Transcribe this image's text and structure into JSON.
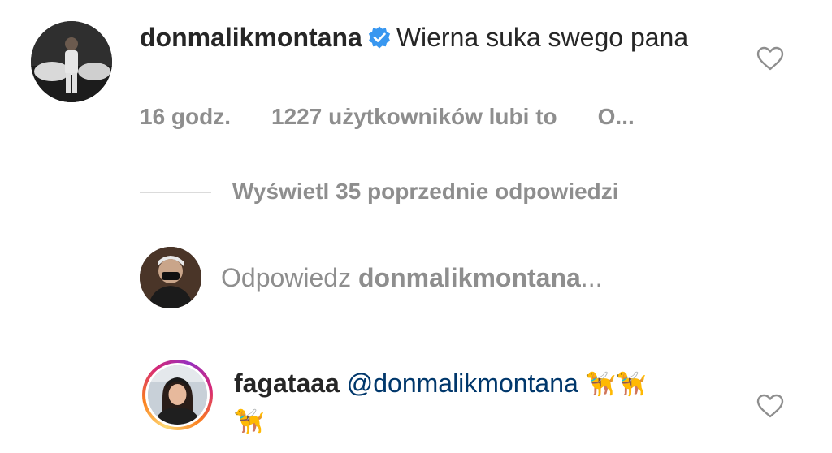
{
  "comment": {
    "username": "donmalikmontana",
    "verified": true,
    "text": "Wierna suka swego pana",
    "time": "16 godz.",
    "likes": "1227 użytkowników lubi to",
    "reply_truncated": "O...",
    "avatar_icon": "profile-photo-man-with-car",
    "like_icon": "heart-outline-icon"
  },
  "previous_replies": {
    "label": "Wyświetl 35 poprzednie odpowiedzi"
  },
  "reply_input": {
    "prefix": "Odpowiedz",
    "username": "donmalikmontana",
    "ellipsis": "..."
  },
  "reply": {
    "username": "fagataaa",
    "mention": "@donmalikmontana",
    "emoji_line1": "🦮🦮",
    "emoji_line2": "🦮",
    "story_ring": true,
    "like_icon": "heart-outline-icon"
  },
  "colors": {
    "verified_blue": "#3897f0",
    "meta_gray": "#8e8e8e",
    "mention_blue": "#00376b"
  }
}
